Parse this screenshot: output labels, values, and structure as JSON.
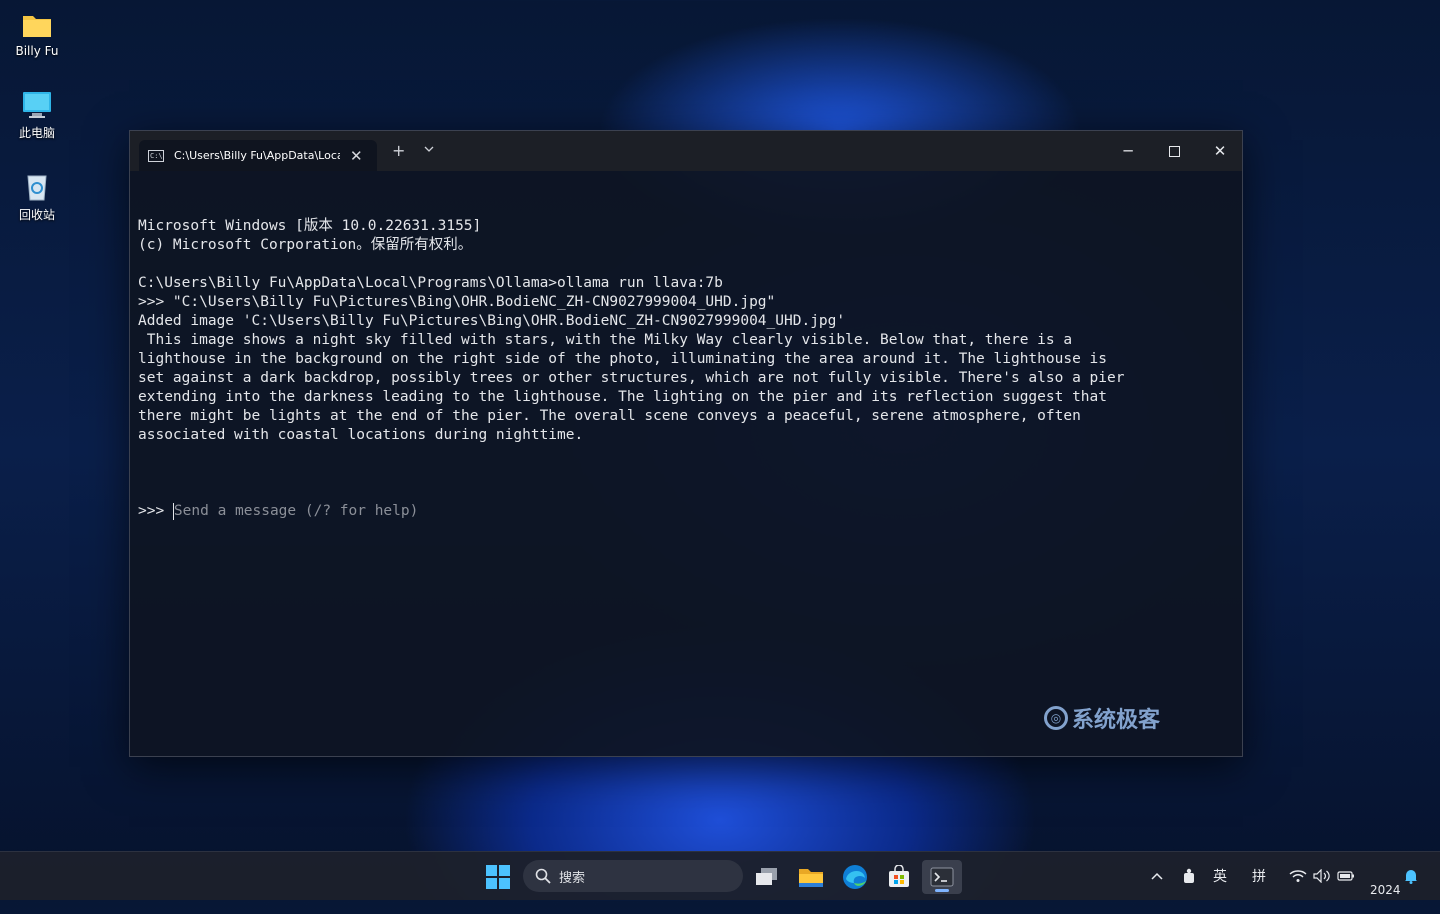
{
  "desktop": {
    "icons": [
      {
        "label": "Billy Fu",
        "icon": "folder-icon"
      },
      {
        "label": "此电脑",
        "icon": "computer-icon"
      },
      {
        "label": "回收站",
        "icon": "recycle-bin-icon"
      }
    ]
  },
  "window": {
    "tab_title": "C:\\Users\\Billy Fu\\AppData\\Local\\Programs\\Ollama",
    "new_tab_label": "+",
    "dropdown_label": "⌄",
    "minimize_label": "─",
    "maximize_label": "☐",
    "close_label": "✕"
  },
  "console": {
    "lines": [
      "Microsoft Windows [版本 10.0.22631.3155]",
      "(c) Microsoft Corporation。保留所有权利。",
      "",
      "C:\\Users\\Billy Fu\\AppData\\Local\\Programs\\Ollama>ollama run llava:7b",
      ">>> \"C:\\Users\\Billy Fu\\Pictures\\Bing\\OHR.BodieNC_ZH-CN9027999004_UHD.jpg\"",
      "Added image 'C:\\Users\\Billy Fu\\Pictures\\Bing\\OHR.BodieNC_ZH-CN9027999004_UHD.jpg'",
      " This image shows a night sky filled with stars, with the Milky Way clearly visible. Below that, there is a",
      "lighthouse in the background on the right side of the photo, illuminating the area around it. The lighthouse is",
      "set against a dark backdrop, possibly trees or other structures, which are not fully visible. There's also a pier",
      "extending into the darkness leading to the lighthouse. The lighting on the pier and its reflection suggest that",
      "there might be lights at the end of the pier. The overall scene conveys a peaceful, serene atmosphere, often",
      "associated with coastal locations during nighttime.",
      ""
    ],
    "prompt": ">>> ",
    "input_value": "",
    "input_placeholder": "Send a message (/? for help)"
  },
  "watermark": "系统极客",
  "taskbar": {
    "search_label": "搜索",
    "apps": [
      "start-icon",
      "task-view-icon",
      "file-explorer-icon",
      "edge-icon",
      "store-icon",
      "terminal-icon"
    ],
    "tray": {
      "chevron": "^",
      "ime_lang": "英",
      "ime_mode": "拼",
      "clock": "2024"
    }
  }
}
